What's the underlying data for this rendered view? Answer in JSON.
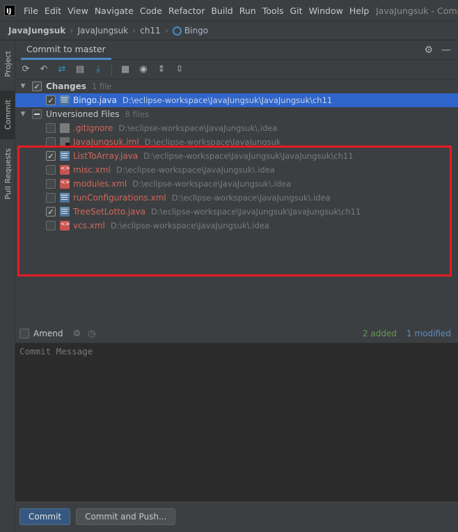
{
  "app": {
    "logo": "IJ",
    "window_title": "JavaJungsuk - Commit"
  },
  "menu": [
    "File",
    "Edit",
    "View",
    "Navigate",
    "Code",
    "Refactor",
    "Build",
    "Run",
    "Tools",
    "Git",
    "Window",
    "Help"
  ],
  "breadcrumb": [
    "JavaJungsuk",
    "JavaJungsuk",
    "ch11",
    "Bingo"
  ],
  "tool_strip": {
    "project": "Project",
    "commit": "Commit",
    "pull_requests": "Pull Requests"
  },
  "panel": {
    "tab": "Commit to master"
  },
  "changes": {
    "label": "Changes",
    "count": "1 file",
    "files": [
      {
        "name": "Bingo.java",
        "path": "D:\\eclipse-workspace\\JavaJungsuk\\JavaJungsuk\\ch11",
        "type": "java",
        "checked": true
      }
    ]
  },
  "unversioned": {
    "label": "Unversioned Files",
    "count": "8 files",
    "files": [
      {
        "name": ".gitignore",
        "path": "D:\\eclipse-workspace\\JavaJungsuk\\.idea",
        "type": "git",
        "checked": false
      },
      {
        "name": "JavaJungsuk.iml",
        "path": "D:\\eclipse-workspace\\JavaJungsuk",
        "type": "iml",
        "checked": false
      },
      {
        "name": "ListToArray.java",
        "path": "D:\\eclipse-workspace\\JavaJungsuk\\JavaJungsuk\\ch11",
        "type": "java",
        "checked": true
      },
      {
        "name": "misc.xml",
        "path": "D:\\eclipse-workspace\\JavaJungsuk\\.idea",
        "type": "xml",
        "checked": false
      },
      {
        "name": "modules.xml",
        "path": "D:\\eclipse-workspace\\JavaJungsuk\\.idea",
        "type": "xml",
        "checked": false
      },
      {
        "name": "runConfigurations.xml",
        "path": "D:\\eclipse-workspace\\JavaJungsuk\\.idea",
        "type": "java",
        "checked": false
      },
      {
        "name": "TreeSetLotto.java",
        "path": "D:\\eclipse-workspace\\JavaJungsuk\\JavaJungsuk\\ch11",
        "type": "java",
        "checked": true
      },
      {
        "name": "vcs.xml",
        "path": "D:\\eclipse-workspace\\JavaJungsuk\\.idea",
        "type": "xml",
        "checked": false
      }
    ]
  },
  "amend": {
    "label": "Amend",
    "added": "2 added",
    "modified": "1 modified"
  },
  "commit_message": {
    "placeholder": "Commit Message"
  },
  "buttons": {
    "commit": "Commit",
    "commit_and_push": "Commit and Push..."
  },
  "colors": {
    "accent": "#4a88c7",
    "selection": "#2f65ca",
    "unversioned_text": "#d1675a",
    "highlight_box": "#e81a24",
    "added": "#629755",
    "modified": "#5d8dc5"
  }
}
